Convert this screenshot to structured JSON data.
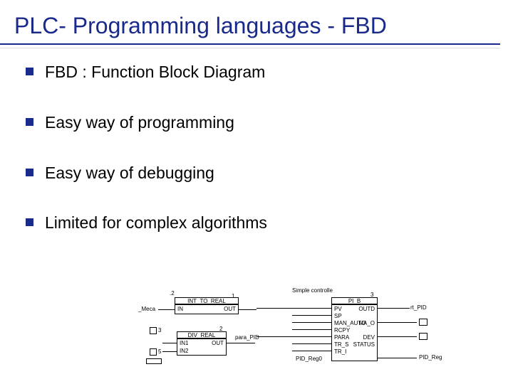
{
  "title": "PLC- Programming languages - FBD",
  "bullets": [
    "FBD : Function Block Diagram",
    "Easy way of programming",
    "Easy  way of debugging",
    "Limited for complex  algorithms"
  ],
  "diagram": {
    "top_right_label": "Simple controlle",
    "block1": {
      "name": "INT_TO_REAL",
      "num_top": ".2",
      "num_in": "1",
      "in": "IN",
      "out": "OUT",
      "left_sig": "_Meca"
    },
    "block2": {
      "name": "DIV_REAL",
      "num": "2",
      "in1": "IN1",
      "in2": "IN2",
      "out": "OUT",
      "sig": "para_PID"
    },
    "block3": {
      "name": "PI_B",
      "num": "3",
      "rows_left": [
        "PV",
        "SP",
        "MAN_AUTO",
        "PARA",
        "TR_S",
        "TR_I",
        "RCPY"
      ],
      "rows_right": [
        "OUTD",
        "MA_O",
        "DEV",
        "STATUS"
      ],
      "right_out_sig": "rt_PID"
    },
    "tiny_boxes": {
      "b3": "3",
      "b5": "5",
      "pid_reg_left": "PID_Reg0",
      "pid_reg_right": "PID_Reg"
    }
  }
}
